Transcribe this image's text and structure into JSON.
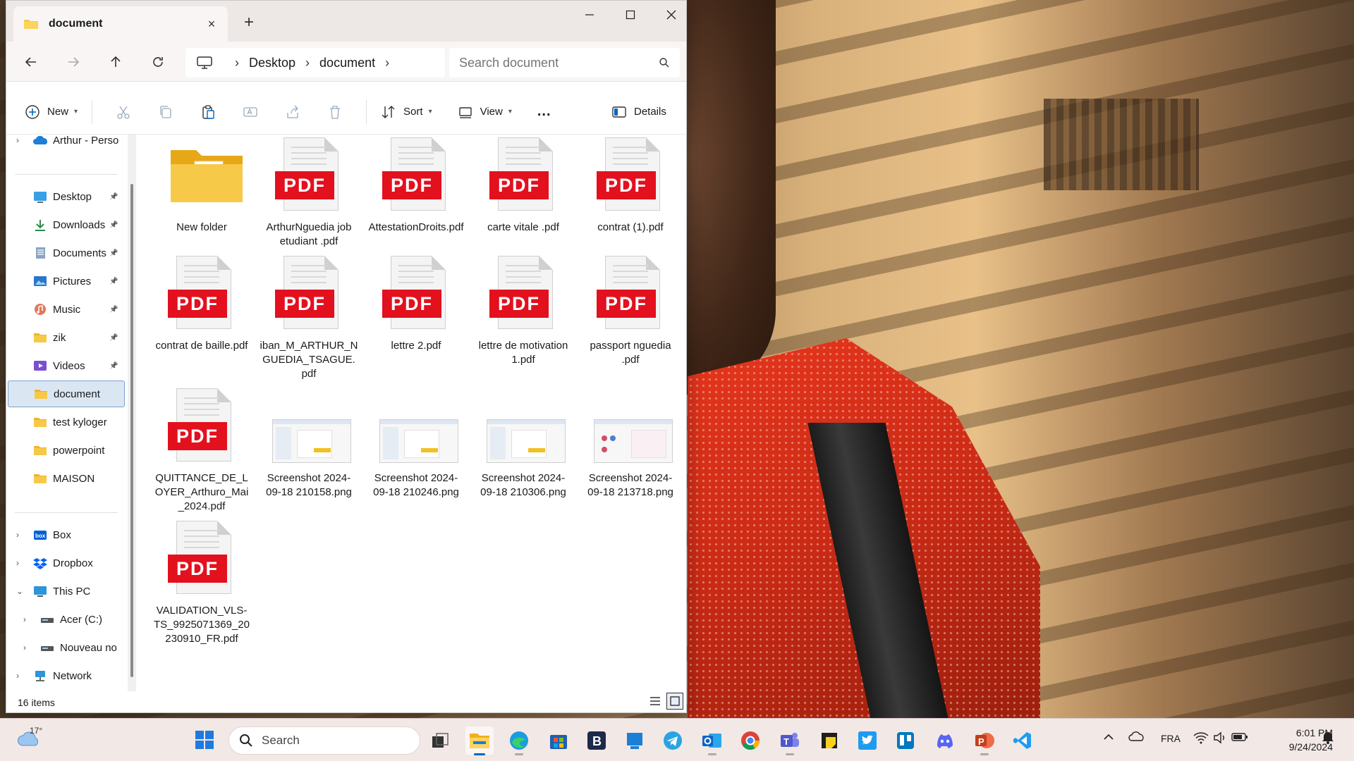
{
  "window": {
    "tab_title": "document",
    "new_tab_glyph": "+"
  },
  "nav": {
    "breadcrumb": [
      "Desktop",
      "document"
    ],
    "search_placeholder": "Search document"
  },
  "toolbar": {
    "new_label": "New",
    "sort_label": "Sort",
    "view_label": "View",
    "more_label": "...",
    "details_label": "Details"
  },
  "sidebar": {
    "items": [
      {
        "label": "Arthur - Perso",
        "icon": "onedrive-cloud-icon",
        "pinned": false
      },
      {
        "label": "Desktop",
        "icon": "desktop-icon",
        "pinned": true
      },
      {
        "label": "Downloads",
        "icon": "download-icon",
        "pinned": true
      },
      {
        "label": "Documents",
        "icon": "documents-icon",
        "pinned": true
      },
      {
        "label": "Pictures",
        "icon": "pictures-icon",
        "pinned": true
      },
      {
        "label": "Music",
        "icon": "music-icon",
        "pinned": true
      },
      {
        "label": "zik",
        "icon": "folder-icon",
        "pinned": true
      },
      {
        "label": "Videos",
        "icon": "videos-icon",
        "pinned": true
      },
      {
        "label": "document",
        "icon": "folder-icon",
        "pinned": false,
        "selected": true
      },
      {
        "label": "test kyloger",
        "icon": "folder-icon",
        "pinned": false
      },
      {
        "label": "powerpoint",
        "icon": "folder-icon",
        "pinned": false
      },
      {
        "label": "MAISON",
        "icon": "folder-icon",
        "pinned": false
      },
      {
        "label": "Box",
        "icon": "box-icon",
        "pinned": false
      },
      {
        "label": "Dropbox",
        "icon": "dropbox-icon",
        "pinned": false
      },
      {
        "label": "This PC",
        "icon": "pc-icon",
        "pinned": false
      },
      {
        "label": "Acer (C:)",
        "icon": "drive-icon",
        "pinned": false
      },
      {
        "label": "Nouveau no",
        "icon": "drive-icon",
        "pinned": false
      },
      {
        "label": "Network",
        "icon": "network-icon",
        "pinned": false
      }
    ]
  },
  "files": [
    {
      "name": "New folder",
      "type": "folder"
    },
    {
      "name": "ArthurNguedia job etudiant .pdf",
      "type": "pdf"
    },
    {
      "name": "AttestationDroits.pdf",
      "type": "pdf"
    },
    {
      "name": "carte vitale .pdf",
      "type": "pdf"
    },
    {
      "name": "contrat (1).pdf",
      "type": "pdf"
    },
    {
      "name": "contrat de baille.pdf",
      "type": "pdf"
    },
    {
      "name": "iban_M_ARTHUR_NGUEDIA_TSAGUE.pdf",
      "type": "pdf"
    },
    {
      "name": "lettre 2.pdf",
      "type": "pdf"
    },
    {
      "name": "lettre de motivation 1.pdf",
      "type": "pdf"
    },
    {
      "name": "passport nguedia .pdf",
      "type": "pdf"
    },
    {
      "name": "QUITTANCE_DE_LOYER_Arthuro_Mai_2024.pdf",
      "type": "pdf"
    },
    {
      "name": "Screenshot 2024-09-18 210158.png",
      "type": "png"
    },
    {
      "name": "Screenshot 2024-09-18 210246.png",
      "type": "png"
    },
    {
      "name": "Screenshot 2024-09-18 210306.png",
      "type": "png"
    },
    {
      "name": "Screenshot 2024-09-18 213718.png",
      "type": "png"
    },
    {
      "name": "VALIDATION_VLS-TS_9925071369_20230910_FR.pdf",
      "type": "pdf"
    }
  ],
  "pdf_badge": "PDF",
  "status": {
    "item_count": "16 items"
  },
  "taskbar": {
    "weather_temp": "17°",
    "search_label": "Search",
    "language": "FRA",
    "time": "6:01 PM",
    "date": "9/24/2024",
    "apps": [
      "file-explorer-icon",
      "edge-icon",
      "microsoft-store-icon",
      "b-app-icon",
      "app-icon",
      "telegram-icon",
      "outlook-icon",
      "chrome-icon",
      "teams-icon",
      "sticky-icon",
      "twitter-icon",
      "trello-icon",
      "discord-icon",
      "powerpoint-icon",
      "vscode-icon"
    ]
  },
  "colors": {
    "accent": "#0067c0",
    "pdf_red": "#e3101e",
    "folder_yellow": "#f7c948",
    "selected_bg": "#dbe6f3"
  }
}
